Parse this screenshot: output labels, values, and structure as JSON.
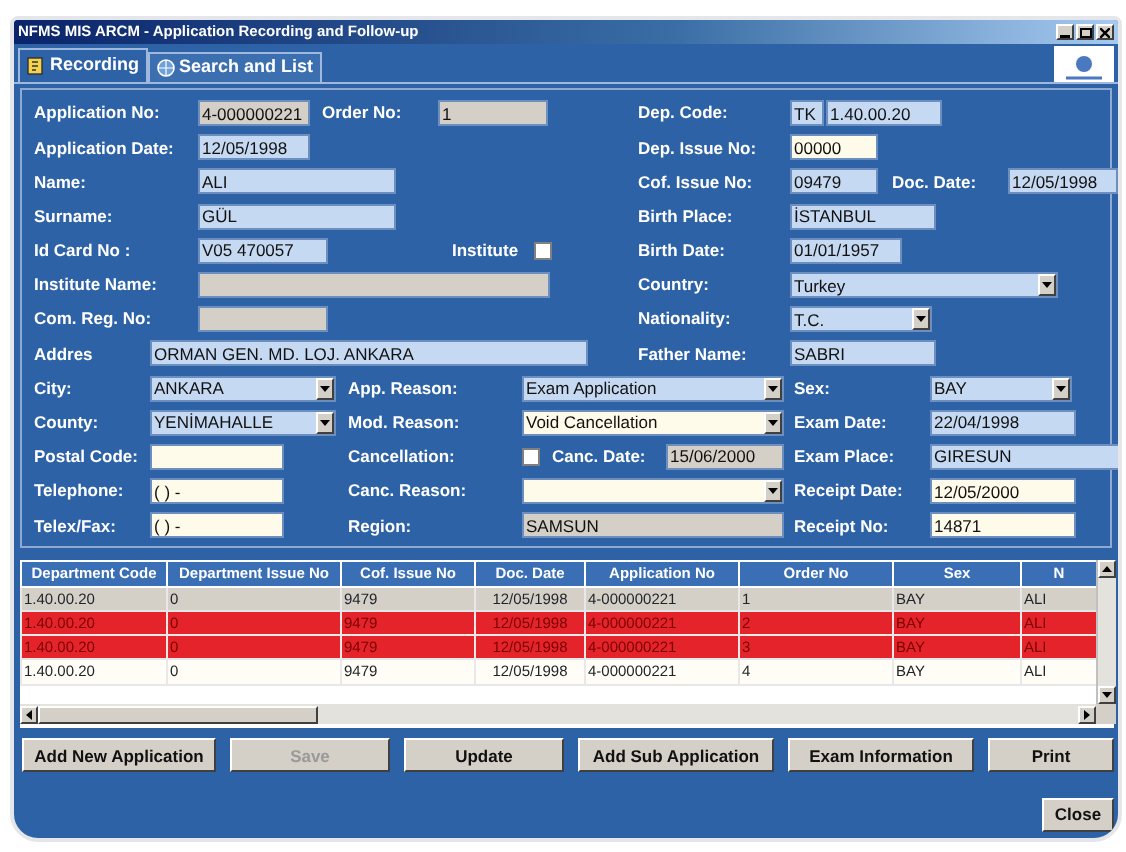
{
  "window": {
    "title": "NFMS MIS ARCM - Application Recording and Follow-up"
  },
  "tabs": [
    {
      "label": "Recording",
      "selected": true
    },
    {
      "label": "Search and List",
      "selected": false
    }
  ],
  "form": {
    "rows": [
      [
        {
          "kind": "label",
          "text": "Application No:"
        },
        {
          "kind": "field",
          "value": "4-000000221",
          "readonly": true,
          "required": false
        },
        {
          "kind": "label",
          "text": "Order No:"
        },
        {
          "kind": "field",
          "value": "1",
          "readonly": true,
          "required": false
        },
        {
          "kind": "label",
          "text": "Dep. Code:"
        },
        {
          "kind": "field",
          "value": "TK",
          "readonly": false,
          "required": false
        },
        {
          "kind": "field",
          "value": "1.40.00.20",
          "readonly": false,
          "required": false
        }
      ],
      [
        {
          "kind": "label",
          "text": "Application  Date:"
        },
        {
          "kind": "field",
          "value": "12/05/1998",
          "readonly": false,
          "required": false
        },
        {
          "kind": "label",
          "text": "Dep. Issue No:"
        },
        {
          "kind": "field",
          "value": "00000",
          "readonly": false,
          "required": true
        }
      ],
      [
        {
          "kind": "label",
          "text": "Name:"
        },
        {
          "kind": "field",
          "value": "ALI",
          "readonly": false,
          "required": false
        },
        {
          "kind": "label",
          "text": "Cof. Issue No:"
        },
        {
          "kind": "field",
          "value": "09479",
          "readonly": false,
          "required": false
        },
        {
          "kind": "label",
          "text": "Doc. Date:"
        },
        {
          "kind": "field",
          "value": "12/05/1998",
          "readonly": false,
          "required": false
        }
      ],
      [
        {
          "kind": "label",
          "text": "Surname:"
        },
        {
          "kind": "field",
          "value": "GÜL",
          "readonly": false,
          "required": false
        },
        {
          "kind": "label",
          "text": "Birth Place:"
        },
        {
          "kind": "field",
          "value": "İSTANBUL",
          "readonly": false,
          "required": false
        }
      ],
      [
        {
          "kind": "label",
          "text": "Id Card No :"
        },
        {
          "kind": "field",
          "value": "V05 470057",
          "readonly": false,
          "required": false
        },
        {
          "kind": "label",
          "text": "Institute"
        },
        {
          "kind": "checkbox",
          "checked": false
        },
        {
          "kind": "label",
          "text": "Birth Date:"
        },
        {
          "kind": "field",
          "value": "01/01/1957",
          "readonly": false,
          "required": false
        }
      ],
      [
        {
          "kind": "label",
          "text": "Institute Name:"
        },
        {
          "kind": "field",
          "readonly": true,
          "required": false
        },
        {
          "kind": "label",
          "text": "Country:"
        },
        {
          "kind": "combo",
          "value": "Turkey",
          "readonly": false,
          "required": false
        }
      ],
      [
        {
          "kind": "label",
          "text": "Com. Reg. No:"
        },
        {
          "kind": "field",
          "readonly": true,
          "required": false
        },
        {
          "kind": "label",
          "text": "Nationality:"
        },
        {
          "kind": "combo",
          "value": "T.C.",
          "readonly": false,
          "required": false
        }
      ],
      [
        {
          "kind": "label",
          "text": "Addres"
        },
        {
          "kind": "field",
          "value": "ORMAN GEN. MD. LOJ. ANKARA",
          "readonly": false,
          "required": false
        },
        {
          "kind": "label",
          "text": "Father Name:"
        },
        {
          "kind": "field",
          "value": "SABRI",
          "readonly": false,
          "required": false
        }
      ],
      [
        {
          "kind": "label",
          "text": "City:"
        },
        {
          "kind": "combo",
          "value": "ANKARA",
          "readonly": false,
          "required": false
        },
        {
          "kind": "label",
          "text": "App. Reason:"
        },
        {
          "kind": "combo",
          "value": "Exam Application",
          "readonly": false,
          "required": false
        },
        {
          "kind": "label",
          "text": "Sex:"
        },
        {
          "kind": "combo",
          "value": "BAY",
          "readonly": false,
          "required": false
        }
      ],
      [
        {
          "kind": "label",
          "text": "County:"
        },
        {
          "kind": "combo",
          "value": "YENİMAHALLE",
          "readonly": false,
          "required": false
        },
        {
          "kind": "label",
          "text": "Mod. Reason:"
        },
        {
          "kind": "combo",
          "value": "Void Cancellation",
          "readonly": false,
          "required": true
        },
        {
          "kind": "label",
          "text": "Exam Date:"
        },
        {
          "kind": "field",
          "value": "22/04/1998",
          "readonly": false,
          "required": false
        }
      ],
      [
        {
          "kind": "label",
          "text": "Postal Code:"
        },
        {
          "kind": "field",
          "readonly": false,
          "required": true
        },
        {
          "kind": "label",
          "text": "Cancellation:"
        },
        {
          "kind": "checkbox",
          "checked": false
        },
        {
          "kind": "label",
          "text": "Canc. Date:"
        },
        {
          "kind": "field",
          "value": "15/06/2000",
          "readonly": true,
          "required": false
        },
        {
          "kind": "label",
          "text": "Exam Place:"
        },
        {
          "kind": "field",
          "value": "GIRESUN",
          "readonly": false,
          "required": false
        }
      ],
      [
        {
          "kind": "label",
          "text": "Telephone:"
        },
        {
          "kind": "field",
          "value": "(  )   -",
          "readonly": false,
          "required": true
        },
        {
          "kind": "label",
          "text": "Canc. Reason:"
        },
        {
          "kind": "combo",
          "readonly": false,
          "required": true
        },
        {
          "kind": "label",
          "text": "Receipt Date:"
        },
        {
          "kind": "field",
          "value": "12/05/2000",
          "readonly": false,
          "required": true
        }
      ],
      [
        {
          "kind": "label",
          "text": "Telex/Fax:"
        },
        {
          "kind": "field",
          "value": "(  )   -",
          "readonly": false,
          "required": true
        },
        {
          "kind": "label",
          "text": "Region:"
        },
        {
          "kind": "field",
          "value": "SAMSUN",
          "readonly": true,
          "required": false
        },
        {
          "kind": "label",
          "text": "Receipt No:"
        },
        {
          "kind": "field",
          "value": "14871",
          "readonly": false,
          "required": true
        }
      ]
    ]
  },
  "table": {
    "columns": [
      "Department Code",
      "Department Issue No",
      "Cof. Issue No",
      "Doc. Date",
      "Application No",
      "Order No",
      "Sex",
      "N"
    ],
    "rows": [
      {
        "selected": true,
        "cancelled": false,
        "cells": [
          "1.40.00.20",
          "0",
          "9479",
          "12/05/1998",
          "4-000000221",
          "1",
          "BAY",
          "ALI"
        ]
      },
      {
        "selected": false,
        "cancelled": true,
        "cells": [
          "1.40.00.20",
          "0",
          "9479",
          "12/05/1998",
          "4-000000221",
          "2",
          "BAY",
          "ALI"
        ]
      },
      {
        "selected": false,
        "cancelled": true,
        "cells": [
          "1.40.00.20",
          "0",
          "9479",
          "12/05/1998",
          "4-000000221",
          "3",
          "BAY",
          "ALI"
        ]
      },
      {
        "selected": false,
        "cancelled": false,
        "cells": [
          "1.40.00.20",
          "0",
          "9479",
          "12/05/1998",
          "4-000000221",
          "4",
          "BAY",
          "ALI"
        ]
      }
    ]
  },
  "buttons": [
    {
      "label": "Add New Application",
      "disabled": false
    },
    {
      "label": "Save",
      "disabled": true
    },
    {
      "label": "Update",
      "disabled": false
    },
    {
      "label": "Add Sub Application",
      "disabled": false
    },
    {
      "label": "Exam Information",
      "disabled": false
    },
    {
      "label": "Print",
      "disabled": false
    }
  ],
  "close_button": "Close"
}
